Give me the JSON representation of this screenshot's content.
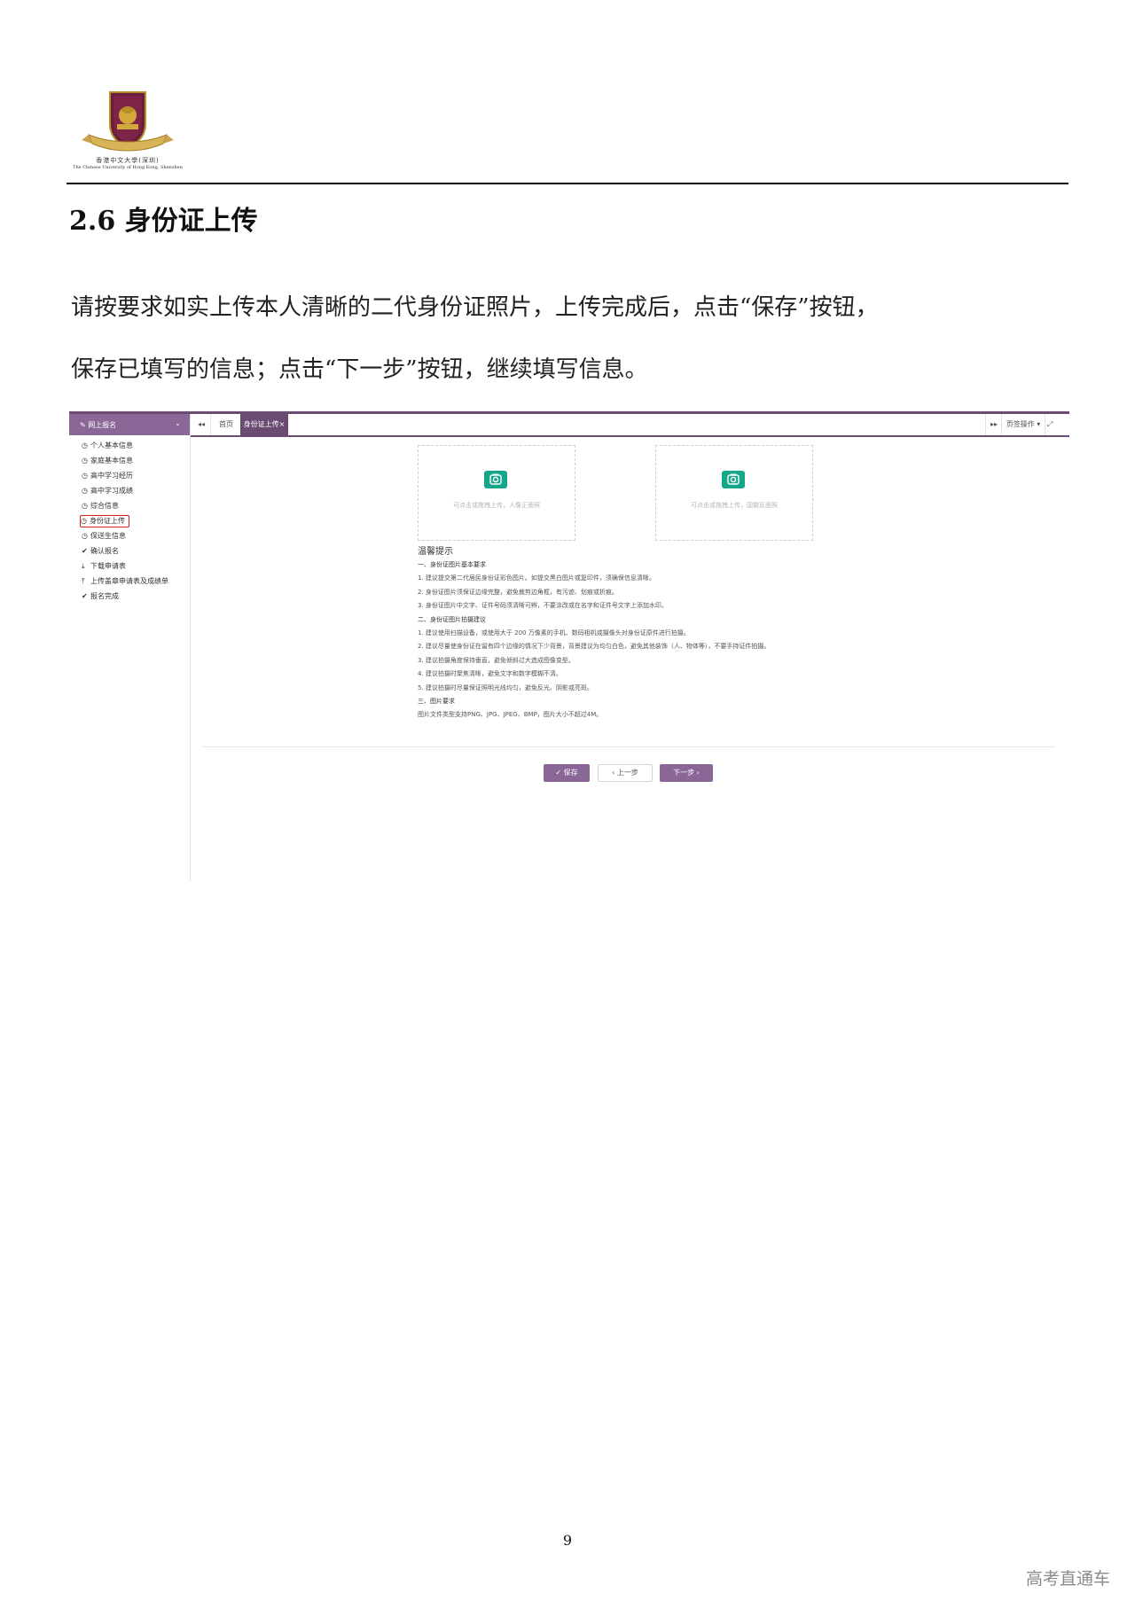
{
  "header": {
    "logo_cn": "香港中文大學(深圳)",
    "logo_en": "The Chinese University of Hong Kong, Shenzhen"
  },
  "section": {
    "title": "2.6  身份证上传",
    "para1": "请按要求如实上传本人清晰的二代身份证照片，上传完成后，点击“保存”按钮，",
    "para2": "保存已填写的信息；点击“下一步”按钮，继续填写信息。"
  },
  "screenshot": {
    "sidebar": {
      "title": "网上报名",
      "items": [
        {
          "icon": "clock-icon",
          "label": "个人基本信息"
        },
        {
          "icon": "clock-icon",
          "label": "家庭基本信息"
        },
        {
          "icon": "clock-icon",
          "label": "高中学习经历"
        },
        {
          "icon": "clock-icon",
          "label": "高中学习成绩"
        },
        {
          "icon": "clock-icon",
          "label": "综合信息"
        },
        {
          "icon": "clock-icon",
          "label": "身份证上传"
        },
        {
          "icon": "clock-icon",
          "label": "保送生信息"
        },
        {
          "icon": "check-icon",
          "label": "确认报名"
        },
        {
          "icon": "download-icon",
          "label": "下载申请表"
        },
        {
          "icon": "upload-icon",
          "label": "上传盖章申请表及成绩单"
        },
        {
          "icon": "check-icon",
          "label": "报名完成"
        }
      ]
    },
    "tabs": {
      "home": "首页",
      "active": "身份证上传",
      "ops": "页签操作"
    },
    "upload": {
      "front_hint": "可点击或拖拽上传，人像正面照",
      "back_hint": "可点击或拖拽上传，国徽反面照"
    },
    "tips": {
      "title": "温馨提示",
      "lines": [
        "一、身份证图片基本要求",
        "1. 建议提交第二代居民身份证彩色图片。如提交黑白图片或复印件，须确保信息清晰。",
        "2. 身份证图片须保证边缘完整，避免裁剪边角框，有污迹、划痕或折痕。",
        "3. 身份证图片中文字、证件号码须清晰可辨，不要涂改或在名字和证件号文字上添加水印。",
        "二、身份证图片拍摄建议",
        "1. 建议使用扫描设备，或使用大于 200 万像素的手机、数码相机或摄像头对身份证原件进行拍摄。",
        "2. 建议尽量使身份证在留有四个边缘的情况下少背景，背景建议为均匀白色，避免其他装饰（人、物体等），不要手持证件拍摄。",
        "3. 建议拍摄角度保持垂直，避免倾斜过大造成图像变型。",
        "4. 建议拍摄时聚焦清晰，避免文字和数字模糊不清。",
        "5. 建议拍摄时尽量保证照明光线均匀，避免反光、阴影或亮斑。",
        "三、图片要求",
        "图片文件类型支持PNG、JPG、JPEG、BMP，图片大小不超过4M。"
      ]
    },
    "buttons": {
      "save": "✓ 保存",
      "prev": "‹ 上一步",
      "next": "下一步 ›"
    },
    "colors": {
      "accent": "#8a6796",
      "camera": "#16a68b",
      "highlight": "#d62020"
    }
  },
  "footer": {
    "page_number": "9",
    "watermark": "高考直通车"
  }
}
